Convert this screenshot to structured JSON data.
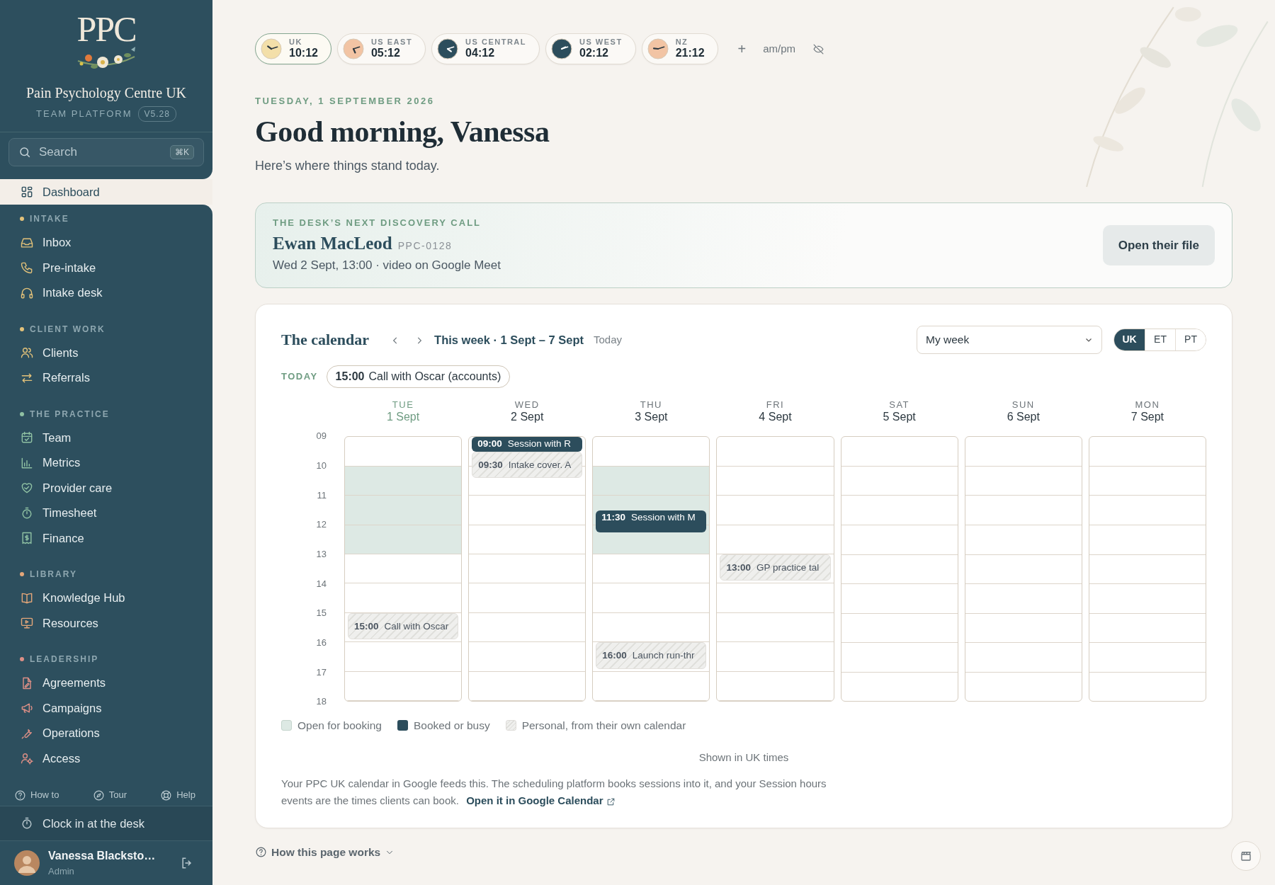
{
  "sidebar": {
    "logo_text": "PPC",
    "title": "Pain Psychology Centre UK",
    "subtitle": "TEAM PLATFORM",
    "version": "V5.28",
    "search": {
      "placeholder": "Search",
      "shortcut": "⌘K"
    },
    "top_item": {
      "label": "Dashboard",
      "selected": true
    },
    "sections": [
      {
        "title": "INTAKE",
        "color": "#e3c27a",
        "items": [
          {
            "label": "Inbox",
            "selected": false
          },
          {
            "label": "Pre-intake",
            "selected": false
          },
          {
            "label": "Intake desk",
            "selected": false
          }
        ]
      },
      {
        "title": "CLIENT WORK",
        "color": "#e3c27a",
        "items": [
          {
            "label": "Clients",
            "selected": false
          },
          {
            "label": "Referrals",
            "selected": false
          }
        ]
      },
      {
        "title": "THE PRACTICE",
        "color": "#8fc1a3",
        "items": [
          {
            "label": "Team",
            "selected": false
          },
          {
            "label": "Metrics",
            "selected": false
          },
          {
            "label": "Provider care",
            "selected": false
          },
          {
            "label": "Timesheet",
            "selected": false
          },
          {
            "label": "Finance",
            "selected": false
          }
        ]
      },
      {
        "title": "LIBRARY",
        "color": "#e3a679",
        "items": [
          {
            "label": "Knowledge Hub",
            "selected": false
          },
          {
            "label": "Resources",
            "selected": false
          }
        ]
      },
      {
        "title": "LEADERSHIP",
        "color": "#dd8f86",
        "items": [
          {
            "label": "Agreements",
            "selected": false
          },
          {
            "label": "Campaigns",
            "selected": false
          },
          {
            "label": "Operations",
            "selected": false
          },
          {
            "label": "Access",
            "selected": false
          }
        ]
      }
    ],
    "footer_links": [
      "How to",
      "Tour",
      "Help"
    ],
    "clock_in": "Clock in at the desk",
    "user": {
      "name": "Vanessa Blacksto…",
      "role": "Admin"
    }
  },
  "clocks": [
    {
      "zone": "UK",
      "time": "10:12",
      "color": "#f3dfa9",
      "selected": true
    },
    {
      "zone": "US EAST",
      "time": "05:12",
      "color": "#f2c4a4",
      "selected": false
    },
    {
      "zone": "US CENTRAL",
      "time": "04:12",
      "color": "#2c4d5c",
      "selected": false
    },
    {
      "zone": "US WEST",
      "time": "02:12",
      "color": "#2c4d5c",
      "selected": false
    },
    {
      "zone": "NZ",
      "time": "21:12",
      "color": "#f2c4a4",
      "selected": false
    }
  ],
  "clock_tools": {
    "add": "+",
    "format": "am/pm"
  },
  "date": "TUESDAY, 1 SEPTEMBER 2026",
  "greeting": "Good morning, Vanessa",
  "intro": "Here’s where things stand today.",
  "discovery": {
    "label": "THE DESK’S NEXT DISCOVERY CALL",
    "name": "Ewan MacLeod",
    "ref": "PPC-0128",
    "detail": "Wed 2 Sept, 13:00 · video on Google Meet",
    "button": "Open their file"
  },
  "calendar": {
    "title": "The calendar",
    "range": "This week · 1 Sept – 7 Sept",
    "today_button": "Today",
    "view": "My week",
    "zones": [
      {
        "label": "UK",
        "selected": true
      },
      {
        "label": "ET",
        "selected": false
      },
      {
        "label": "PT",
        "selected": false
      }
    ],
    "today_label": "TODAY",
    "today_events": [
      {
        "time": "15:00",
        "title": "Call with Oscar (accounts)"
      }
    ],
    "hours": [
      "09",
      "10",
      "11",
      "12",
      "13",
      "14",
      "15",
      "16",
      "17",
      "18"
    ],
    "days": [
      {
        "weekday": "TUE",
        "date": "1 Sept",
        "today": true,
        "slots": [
          {
            "open": false
          },
          {
            "open": true
          },
          {
            "open": true
          },
          {
            "open": true
          },
          {
            "open": false
          },
          {
            "open": false
          },
          {
            "open": false
          },
          {
            "open": false
          },
          {
            "open": false
          }
        ],
        "events": [
          {
            "kind": "personal",
            "time": "15:00",
            "title": "Call with Oscar"
          }
        ]
      },
      {
        "weekday": "WED",
        "date": "2 Sept",
        "today": false,
        "slots": [
          {
            "open": false
          },
          {
            "open": false
          },
          {
            "open": false
          },
          {
            "open": false
          },
          {
            "open": false
          },
          {
            "open": false
          },
          {
            "open": false
          },
          {
            "open": false
          },
          {
            "open": false
          }
        ],
        "events": [
          {
            "kind": "busy",
            "time": "09:00",
            "title": "Session with R"
          },
          {
            "kind": "personal",
            "time": "09:30",
            "title": "Intake cover. A"
          }
        ]
      },
      {
        "weekday": "THU",
        "date": "3 Sept",
        "today": false,
        "slots": [
          {
            "open": false
          },
          {
            "open": true
          },
          {
            "open": true
          },
          {
            "open": true
          },
          {
            "open": false
          },
          {
            "open": false
          },
          {
            "open": false
          },
          {
            "open": false
          },
          {
            "open": false
          }
        ],
        "events": [
          {
            "kind": "busy",
            "time": "11:30",
            "title": "Session with M"
          },
          {
            "kind": "personal",
            "time": "16:00",
            "title": "Launch run-thr"
          }
        ]
      },
      {
        "weekday": "FRI",
        "date": "4 Sept",
        "today": false,
        "slots": [
          {
            "open": false
          },
          {
            "open": false
          },
          {
            "open": false
          },
          {
            "open": false
          },
          {
            "open": false
          },
          {
            "open": false
          },
          {
            "open": false
          },
          {
            "open": false
          },
          {
            "open": false
          }
        ],
        "events": [
          {
            "kind": "personal",
            "time": "13:00",
            "title": "GP practice tal"
          }
        ]
      },
      {
        "weekday": "SAT",
        "date": "5 Sept",
        "today": false,
        "slots": [
          {
            "open": false
          },
          {
            "open": false
          },
          {
            "open": false
          },
          {
            "open": false
          },
          {
            "open": false
          },
          {
            "open": false
          },
          {
            "open": false
          },
          {
            "open": false
          },
          {
            "open": false
          }
        ]
      },
      {
        "weekday": "SUN",
        "date": "6 Sept",
        "today": false,
        "slots": [
          {
            "open": false
          },
          {
            "open": false
          },
          {
            "open": false
          },
          {
            "open": false
          },
          {
            "open": false
          },
          {
            "open": false
          },
          {
            "open": false
          },
          {
            "open": false
          },
          {
            "open": false
          }
        ]
      },
      {
        "weekday": "MON",
        "date": "7 Sept",
        "today": false,
        "slots": [
          {
            "open": false
          },
          {
            "open": false
          },
          {
            "open": false
          },
          {
            "open": false
          },
          {
            "open": false
          },
          {
            "open": false
          },
          {
            "open": false
          },
          {
            "open": false
          },
          {
            "open": false
          }
        ]
      }
    ],
    "legend": [
      {
        "kind": "open",
        "label": "Open for booking"
      },
      {
        "kind": "busy",
        "label": "Booked or busy"
      },
      {
        "kind": "personal",
        "label": "Personal, from their own calendar"
      }
    ],
    "timezone_note": "Shown in UK times",
    "note": "Your PPC UK calendar in Google feeds this. The scheduling platform books sessions into it, and your Session hours events are the times clients can book.",
    "link": "Open it in Google Calendar"
  },
  "help_toggle": "How this page works"
}
